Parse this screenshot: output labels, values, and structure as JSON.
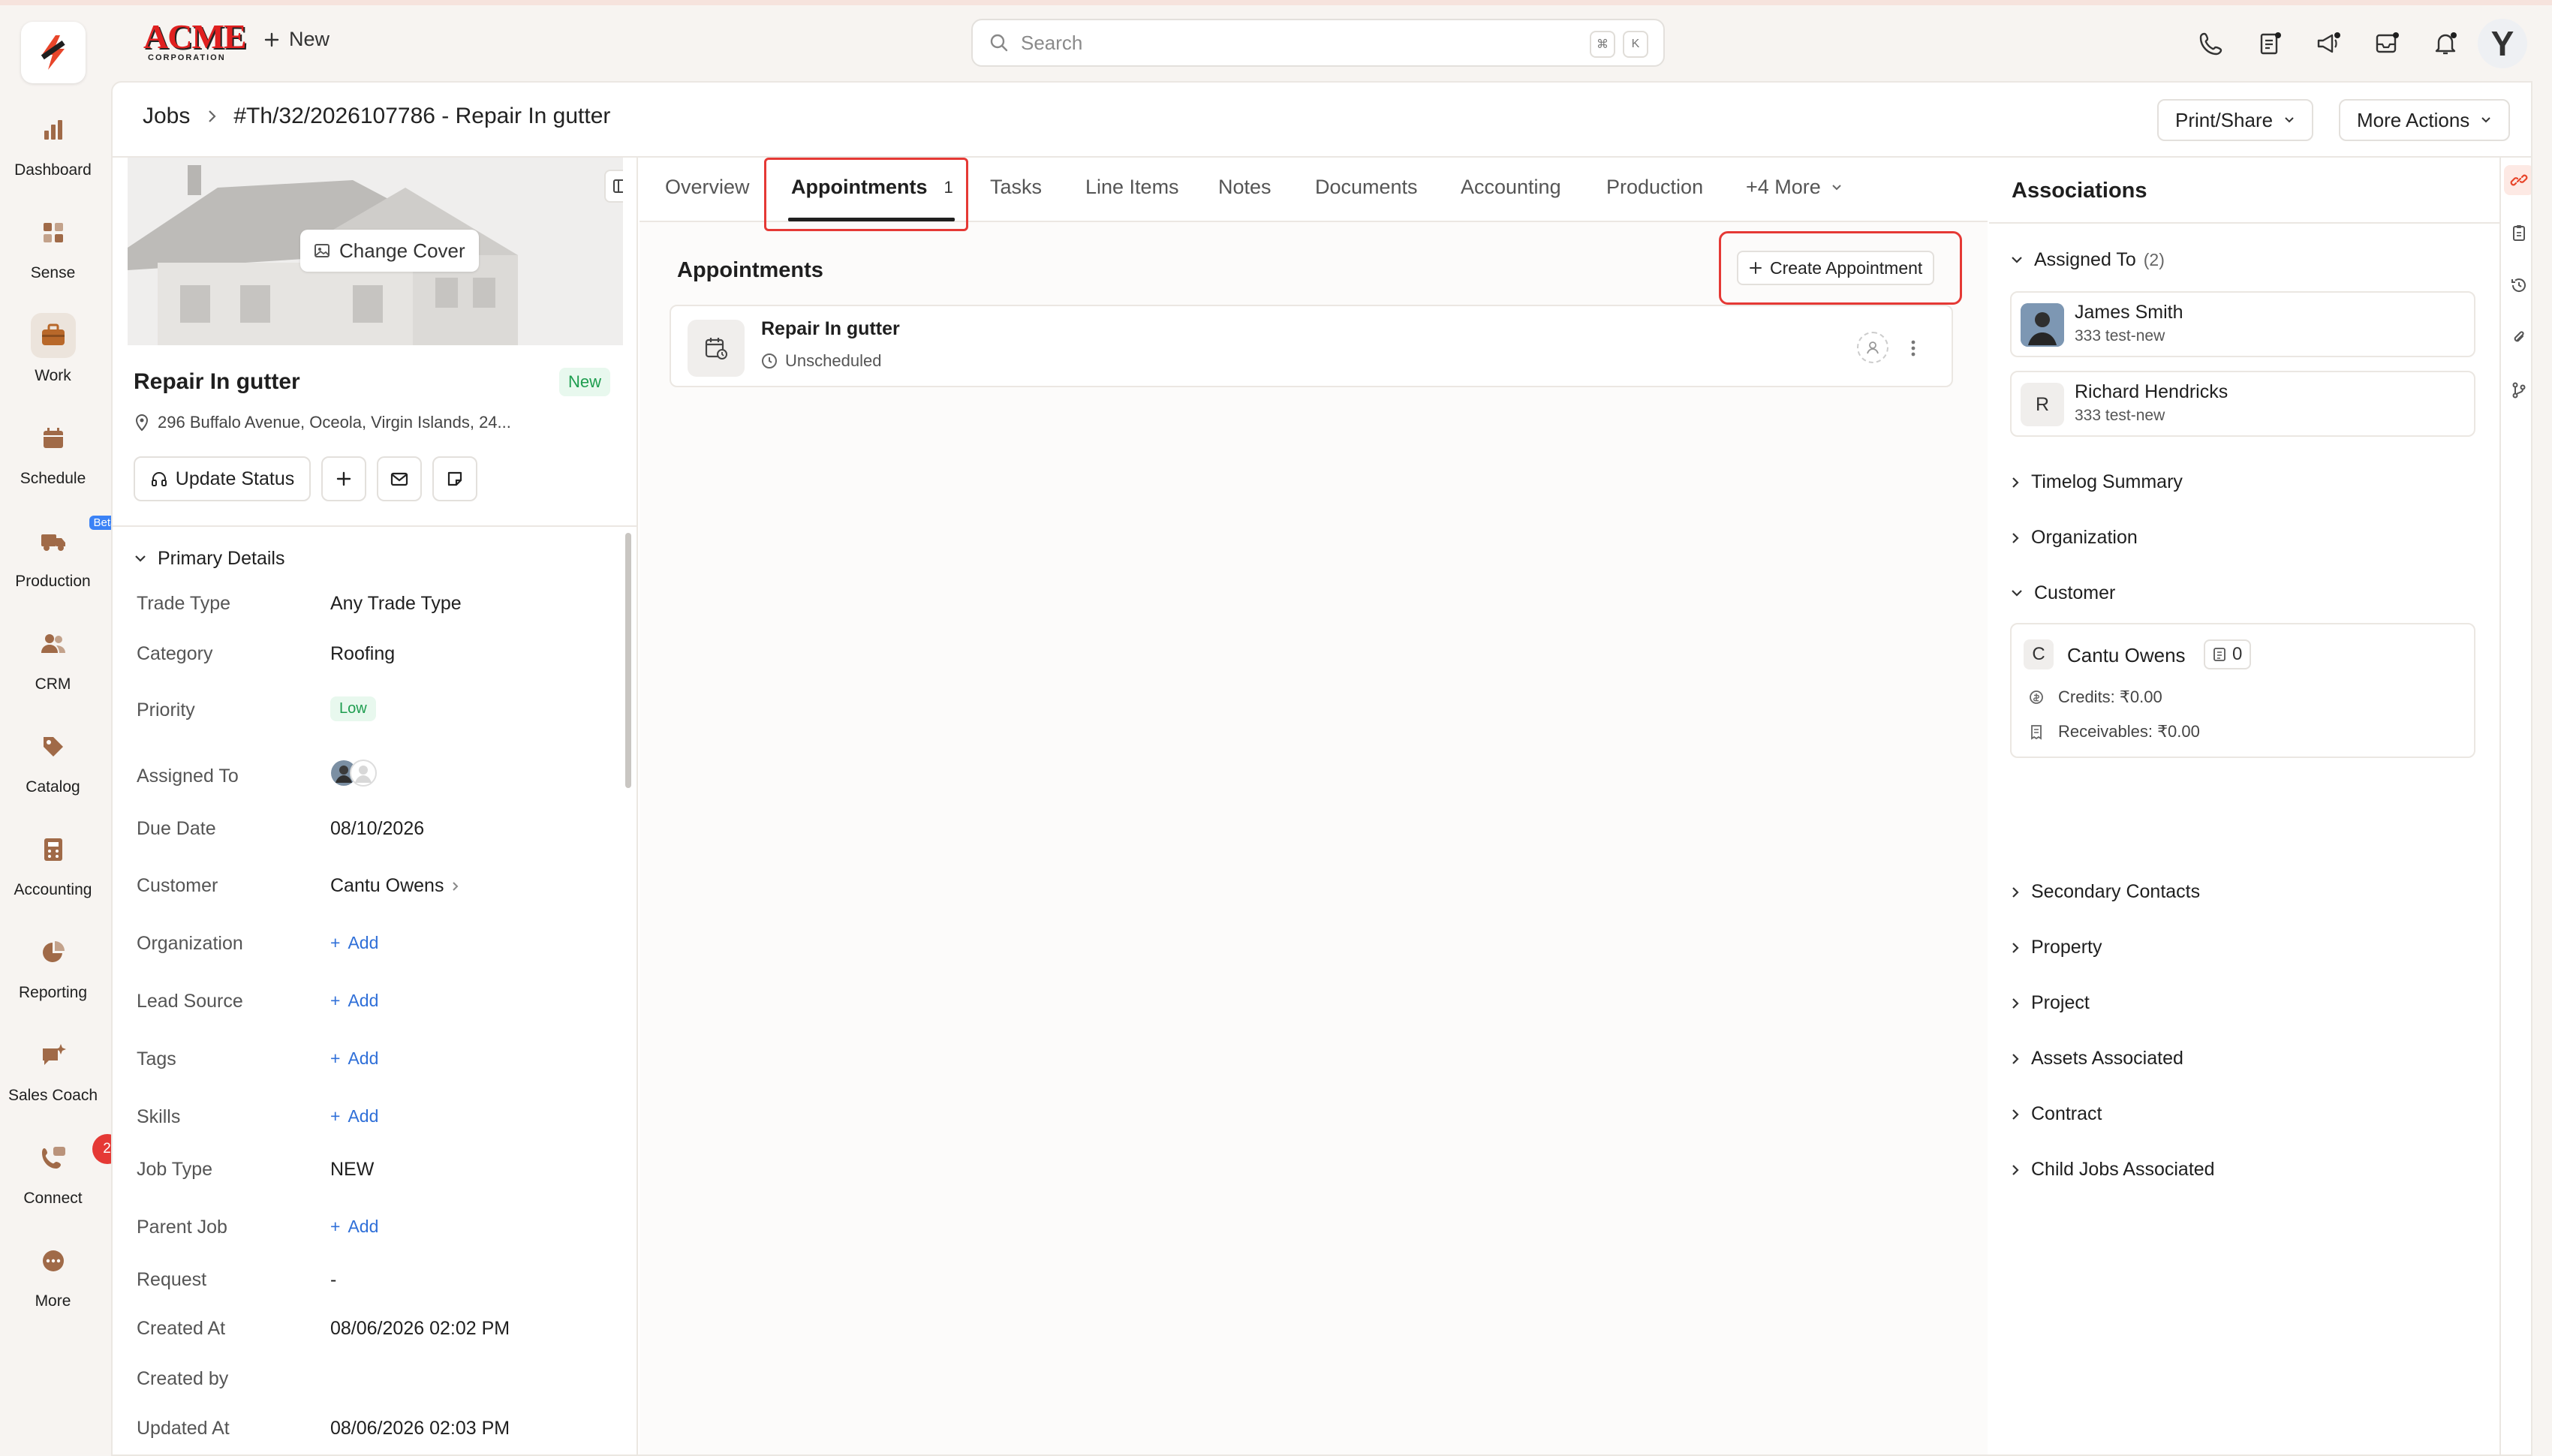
{
  "brand": {
    "name": "ACME",
    "sub": "CORPORATION"
  },
  "topbar": {
    "new_label": "New",
    "search_placeholder": "Search",
    "kbd_cmd": "⌘",
    "kbd_k": "K",
    "avatar": "Y"
  },
  "nav": [
    {
      "label": "Dashboard",
      "icon": "bar-chart-icon"
    },
    {
      "label": "Sense",
      "icon": "grid-icon"
    },
    {
      "label": "Work",
      "icon": "briefcase-icon"
    },
    {
      "label": "Schedule",
      "icon": "calendar-icon"
    },
    {
      "label": "Production",
      "icon": "truck-icon",
      "badge": "Beta"
    },
    {
      "label": "CRM",
      "icon": "users-icon"
    },
    {
      "label": "Catalog",
      "icon": "tag-icon"
    },
    {
      "label": "Accounting",
      "icon": "calculator-icon"
    },
    {
      "label": "Reporting",
      "icon": "pie-chart-icon"
    },
    {
      "label": "Sales Coach",
      "icon": "sparkle-chat-icon"
    },
    {
      "label": "Connect",
      "icon": "phone-chat-icon",
      "count": "2"
    },
    {
      "label": "More",
      "icon": "more-icon"
    }
  ],
  "breadcrumb": {
    "root": "Jobs",
    "current": "#Th/32/2026107786 - Repair In gutter"
  },
  "header_actions": {
    "print_share": "Print/Share",
    "more_actions": "More Actions"
  },
  "job": {
    "change_cover": "Change Cover",
    "title": "Repair In gutter",
    "status": "New",
    "address": "296 Buffalo Avenue, Oceola, Virgin Islands, 24...",
    "update_status": "Update Status"
  },
  "primary_details": {
    "heading": "Primary Details",
    "trade_type": {
      "label": "Trade Type",
      "value": "Any Trade Type"
    },
    "category": {
      "label": "Category",
      "value": "Roofing"
    },
    "priority": {
      "label": "Priority",
      "value": "Low"
    },
    "assigned_to": {
      "label": "Assigned To"
    },
    "due_date": {
      "label": "Due Date",
      "value": "08/10/2026"
    },
    "customer": {
      "label": "Customer",
      "value": "Cantu Owens"
    },
    "organization": {
      "label": "Organization",
      "value": "Add"
    },
    "lead_source": {
      "label": "Lead Source",
      "value": "Add"
    },
    "tags": {
      "label": "Tags",
      "value": "Add"
    },
    "skills": {
      "label": "Skills",
      "value": "Add"
    },
    "job_type": {
      "label": "Job Type",
      "value": "NEW"
    },
    "parent_job": {
      "label": "Parent Job",
      "value": "Add"
    },
    "request": {
      "label": "Request",
      "value": "-"
    },
    "created_at": {
      "label": "Created At",
      "value": "08/06/2026 02:02 PM"
    },
    "created_by": {
      "label": "Created by",
      "value": ""
    },
    "updated_at": {
      "label": "Updated At",
      "value": "08/06/2026 02:03 PM"
    }
  },
  "tabs": {
    "overview": "Overview",
    "appointments": "Appointments",
    "appointments_count": "1",
    "tasks": "Tasks",
    "line_items": "Line Items",
    "notes": "Notes",
    "documents": "Documents",
    "accounting": "Accounting",
    "production": "Production",
    "more": "+4 More"
  },
  "appointments": {
    "heading": "Appointments",
    "create_label": "Create Appointment",
    "items": [
      {
        "title": "Repair In gutter",
        "status": "Unscheduled"
      }
    ]
  },
  "associations": {
    "title": "Associations",
    "assigned_to": {
      "label": "Assigned To",
      "count": "(2)"
    },
    "people": [
      {
        "name": "James Smith",
        "sub": "333 test-new",
        "initial": ""
      },
      {
        "name": "Richard Hendricks",
        "sub": "333 test-new",
        "initial": "R"
      }
    ],
    "timelog": "Timelog Summary",
    "organization": "Organization",
    "customer_label": "Customer",
    "customer": {
      "initial": "C",
      "name": "Cantu Owens",
      "doc_count": "0",
      "credits": "Credits: ₹0.00",
      "receivables": "Receivables: ₹0.00"
    },
    "secondary_contacts": "Secondary Contacts",
    "property": "Property",
    "project": "Project",
    "assets": "Assets Associated",
    "contract": "Contract",
    "child_jobs": "Child Jobs Associated"
  },
  "colors": {
    "accent": "#e53935",
    "link": "#2f6fd8",
    "success": "#1e9d4f",
    "brand_red": "#e02020"
  }
}
